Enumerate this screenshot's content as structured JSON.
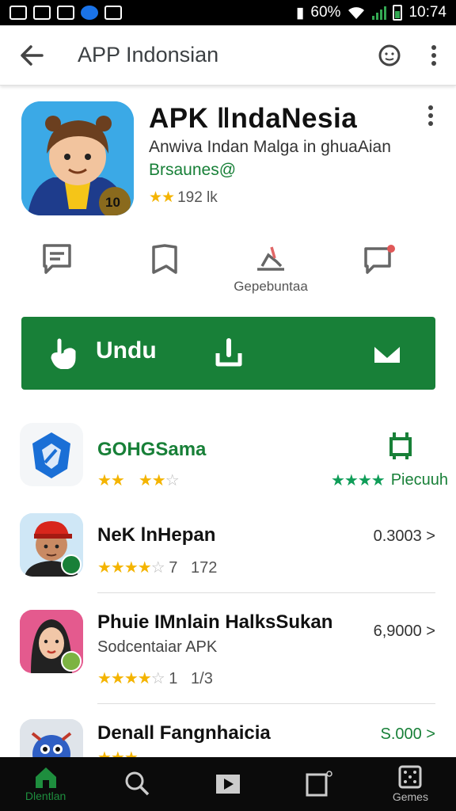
{
  "status_bar": {
    "battery": "60%",
    "time": "10:74"
  },
  "top_bar": {
    "title": "APP Indonsian"
  },
  "app": {
    "name": "APK ‖ndaNesia",
    "subtitle": "Anwiva Indan Malga in ghuaAian",
    "developer": "Brsaunes@",
    "rating_count": "192 lk",
    "icon_badge": "10",
    "brand_color": "#188038"
  },
  "actions": {
    "items": [
      {
        "icon": "comment-icon",
        "label": ""
      },
      {
        "icon": "bookmark-icon",
        "label": ""
      },
      {
        "icon": "donate-icon",
        "label": "Gepebuntaa"
      },
      {
        "icon": "message-notify-icon",
        "label": ""
      }
    ]
  },
  "install": {
    "label": "Undu"
  },
  "list": [
    {
      "title": "GOHGSama",
      "subtitle": "",
      "rating_text": "",
      "right_text": "Piecuuh",
      "stars": 2,
      "icon": "shield-logo-icon"
    },
    {
      "title": "NeK lnHepan",
      "subtitle": "",
      "rating_text": "7   172",
      "right_text": "0.3003 >",
      "stars": 4,
      "icon": "avatar-red-cap-icon"
    },
    {
      "title": "Phuie IMnlain HalksSukan",
      "subtitle": "Sodcentaiar APK",
      "rating_text": "1   1/3",
      "right_text": "6,9000 >",
      "stars": 4,
      "icon": "avatar-woman-icon"
    },
    {
      "title": "Denall Fangnhaicia",
      "subtitle": "",
      "rating_text": "",
      "right_text": "S.000 >",
      "stars": 3,
      "icon": "monster-avatar-icon"
    }
  ],
  "bottom_nav": [
    {
      "label": "Dlentlan",
      "icon": "home-icon",
      "active": true
    },
    {
      "label": "",
      "icon": "search-icon",
      "active": false
    },
    {
      "label": "",
      "icon": "play-icon",
      "active": false
    },
    {
      "label": "",
      "icon": "tablet-icon",
      "active": false
    },
    {
      "label": "Gemes",
      "icon": "dice-icon",
      "active": false
    }
  ]
}
